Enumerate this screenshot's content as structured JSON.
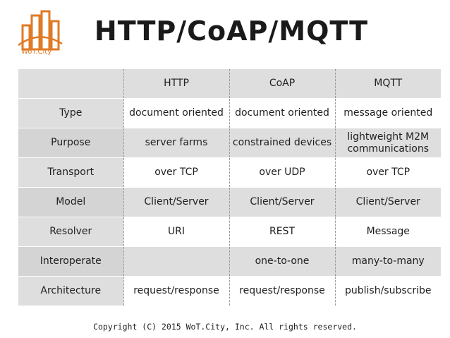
{
  "logo": {
    "text": "WoT.City"
  },
  "title": "HTTP/CoAP/MQTT",
  "table": {
    "headers": [
      "",
      "HTTP",
      "CoAP",
      "MQTT"
    ],
    "rows": [
      [
        "Type",
        "document oriented",
        "document oriented",
        "message oriented"
      ],
      [
        "Purpose",
        "server farms",
        "constrained devices",
        "lightweight M2M communications"
      ],
      [
        "Transport",
        "over TCP",
        "over UDP",
        "over TCP"
      ],
      [
        "Model",
        "Client/Server",
        "Client/Server",
        "Client/Server"
      ],
      [
        "Resolver",
        "URI",
        "REST",
        "Message"
      ],
      [
        "Interoperate",
        "",
        "one-to-one",
        "many-to-many"
      ],
      [
        "Architecture",
        "request/response",
        "request/response",
        "publish/subscribe"
      ]
    ]
  },
  "footer": "Copyright (C) 2015 WoT.City, Inc.  All rights reserved.",
  "colors": {
    "logo_accent": "#e07a24",
    "header_bg": "#dedede",
    "title": "#1a1a1a"
  }
}
